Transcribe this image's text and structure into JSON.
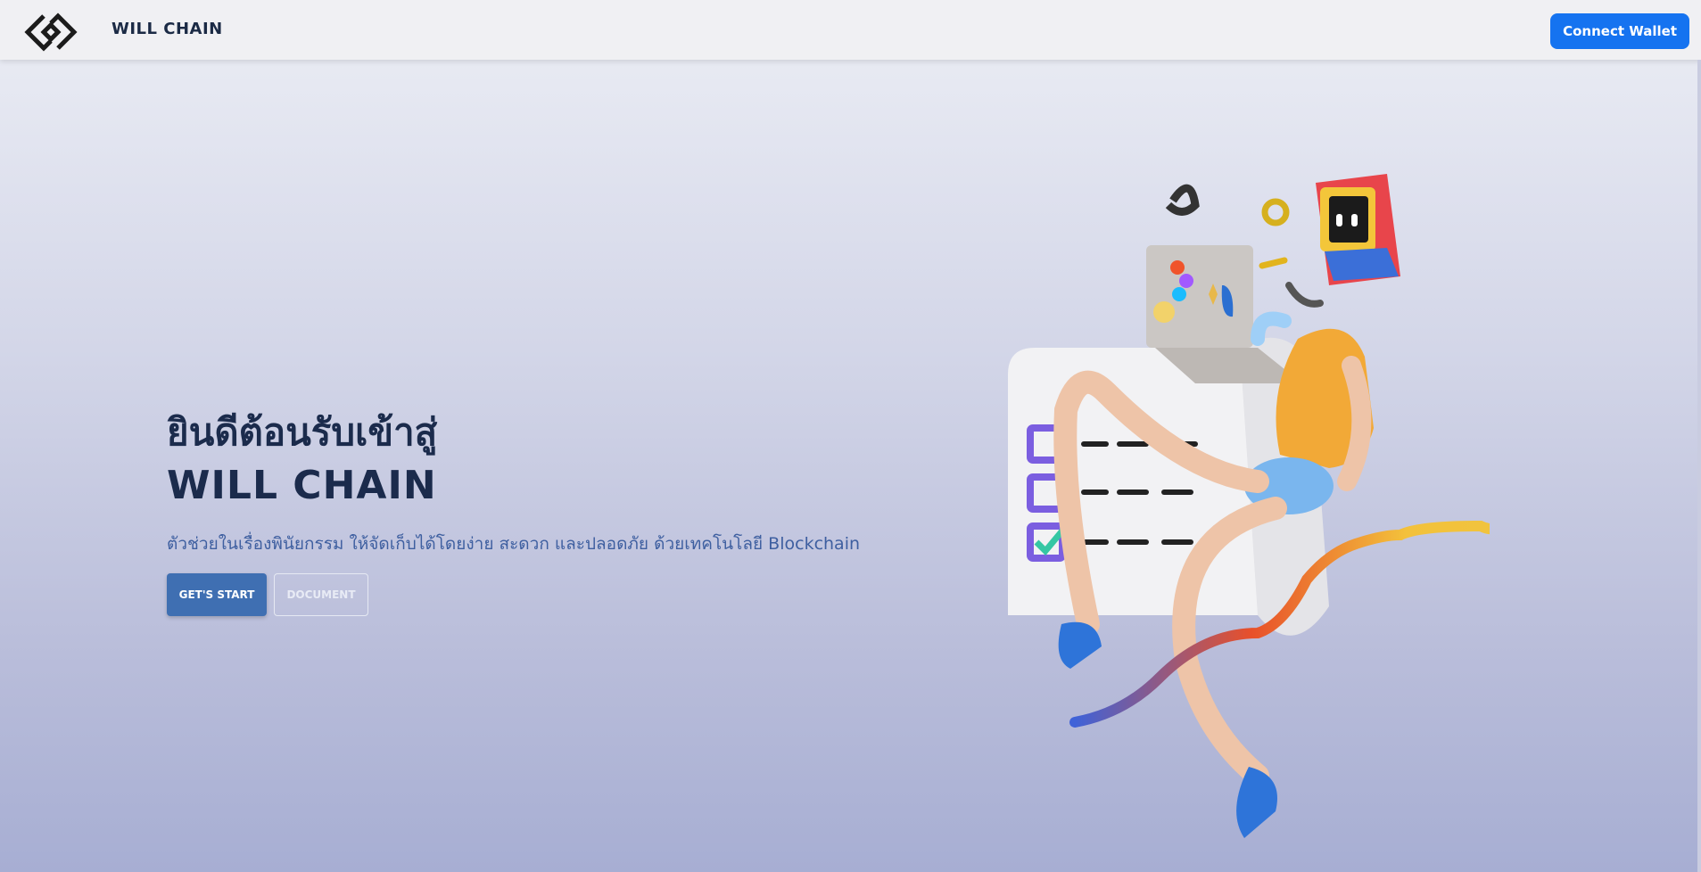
{
  "navbar": {
    "brand": "WILL CHAIN",
    "logo_icon": "chain-link-diamond-icon",
    "connect_wallet_label": "Connect Wallet"
  },
  "hero": {
    "title_thai": "ยินดีต้อนรับเข้าสู่",
    "title_en": "WILL CHAIN",
    "description": "ตัวช่วยในเรื่องพินัยกรรม ให้จัดเก็บได้โดยง่าย สะดวก และปลอดภัย ด้วยเทคโนโลยี Blockchain",
    "get_start_label": "GET'S START",
    "document_label": "DOCUMENT"
  },
  "colors": {
    "accent": "#1573f0",
    "primary_button": "#3f6fb2",
    "title": "#1b2b4c",
    "description": "#3e5fa0"
  },
  "illustration": {
    "icon": "3d-character-checklist-laptop-illustration"
  }
}
